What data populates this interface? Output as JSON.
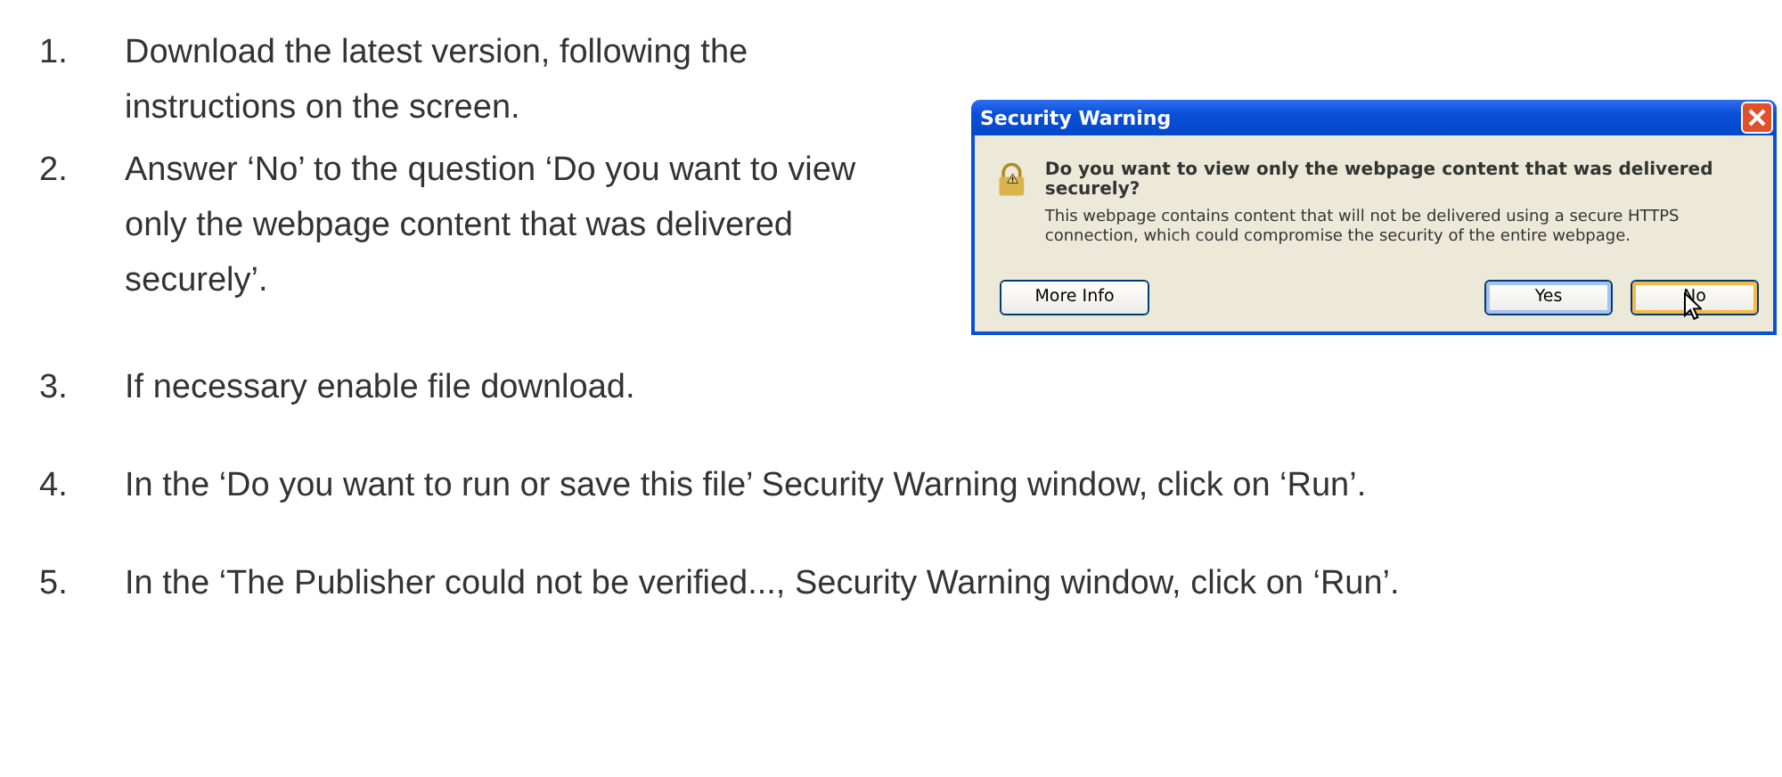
{
  "steps": [
    {
      "number": "1.",
      "text": "Download the latest version, following the instructions on the screen."
    },
    {
      "number": "2.",
      "text": "Answer ‘No’ to the question ‘Do you want to view only the webpage content that was delivered securely’."
    },
    {
      "number": "3.",
      "text": "If necessary enable file download."
    },
    {
      "number": "4.",
      "text": "In the ‘Do you want to run or save this file’ Security Warning window, click on ‘Run’."
    },
    {
      "number": "5.",
      "text": "In the ‘The Publisher could not be verified..., Security Warning window, click on ‘Run’."
    }
  ],
  "dialog": {
    "title": "Security Warning",
    "question": "Do you want to view only the webpage content that was delivered securely?",
    "message": "This webpage contains content that will not be delivered using a secure HTTPS connection, which could compromise the security of the entire webpage.",
    "buttons": [
      {
        "label": "More Info",
        "focused": false
      },
      {
        "label": "Yes",
        "focused": false
      },
      {
        "label": "No",
        "focused": true
      }
    ]
  }
}
